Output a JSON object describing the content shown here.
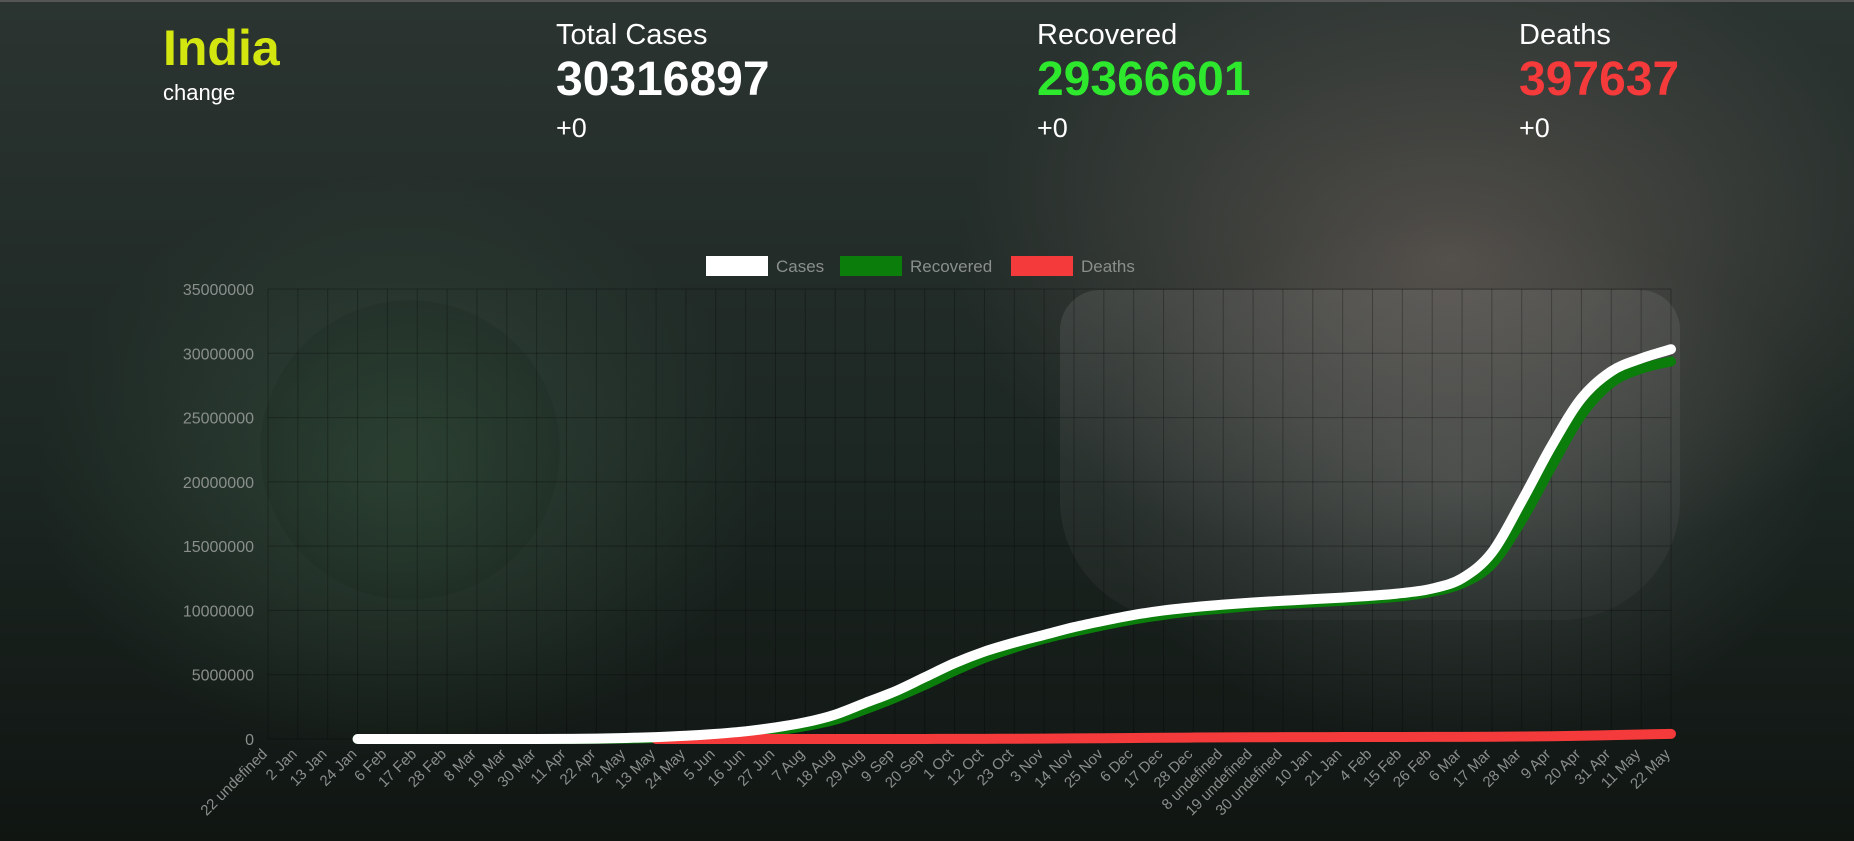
{
  "header": {
    "country": "India",
    "change_label": "change"
  },
  "stats": {
    "cases": {
      "label": "Total Cases",
      "value": "30316897",
      "delta": "+0",
      "color": "#ffffff"
    },
    "recovered": {
      "label": "Recovered",
      "value": "29366601",
      "delta": "+0",
      "color": "#2ee82e"
    },
    "deaths": {
      "label": "Deaths",
      "value": "397637",
      "delta": "+0",
      "color": "#f43a3a"
    }
  },
  "chart_data": {
    "type": "line",
    "grid": true,
    "legend_position": "top-center",
    "ylim": [
      0,
      35000000
    ],
    "yticks": [
      0,
      5000000,
      10000000,
      15000000,
      20000000,
      25000000,
      30000000,
      35000000
    ],
    "x": [
      "22 undefined",
      "2 Jan",
      "13 Jan",
      "24 Jan",
      "6 Feb",
      "17 Feb",
      "28 Feb",
      "8 Mar",
      "19 Mar",
      "30 Mar",
      "11 Apr",
      "22 Apr",
      "2 May",
      "13 May",
      "24 May",
      "5 Jun",
      "16 Jun",
      "27 Jun",
      "7 Aug",
      "18 Aug",
      "29 Aug",
      "9 Sep",
      "20 Sep",
      "1 Oct",
      "12 Oct",
      "23 Oct",
      "3 Nov",
      "14 Nov",
      "25 Nov",
      "6 Dec",
      "17 Dec",
      "28 Dec",
      "8 undefined",
      "19 undefined",
      "30 undefined",
      "10 Jan",
      "21 Jan",
      "4 Feb",
      "15 Feb",
      "26 Feb",
      "6 Mar",
      "17 Mar",
      "28 Mar",
      "9 Apr",
      "20 Apr",
      "31 Apr",
      "11 May",
      "22 May"
    ],
    "series": [
      {
        "name": "Cases",
        "color": "#ffffff",
        "values": [
          0,
          0,
          0,
          0,
          0,
          0,
          0,
          10000,
          30000,
          80000,
          150000,
          250000,
          400000,
          600000,
          900000,
          1300000,
          1900000,
          2800000,
          3700000,
          4800000,
          5900000,
          6800000,
          7500000,
          8100000,
          8700000,
          9200000,
          9650000,
          10000000,
          10250000,
          10450000,
          10620000,
          10750000,
          10880000,
          11000000,
          11150000,
          11350000,
          11700000,
          12500000,
          14500000,
          18500000,
          22800000,
          26500000,
          28600000,
          29600000,
          30316897
        ]
      },
      {
        "name": "Recovered",
        "color": "#0a7d0a",
        "values": [
          0,
          0,
          0,
          0,
          0,
          0,
          0,
          0,
          10000,
          30000,
          70000,
          150000,
          250000,
          400000,
          650000,
          1000000,
          1500000,
          2300000,
          3200000,
          4200000,
          5300000,
          6300000,
          7100000,
          7800000,
          8350000,
          8850000,
          9300000,
          9650000,
          9950000,
          10150000,
          10350000,
          10500000,
          10620000,
          10750000,
          10900000,
          11100000,
          11450000,
          12100000,
          13600000,
          17000000,
          21200000,
          25200000,
          27700000,
          28800000,
          29366601
        ]
      },
      {
        "name": "Deaths",
        "color": "#f43a3a",
        "values": [
          0,
          0,
          0,
          0,
          0,
          0,
          0,
          0,
          2000,
          4000,
          8000,
          14000,
          20000,
          30000,
          45000,
          62000,
          80000,
          98000,
          112000,
          125000,
          134000,
          142000,
          148000,
          152000,
          155000,
          158000,
          162000,
          168000,
          176000,
          190000,
          215000,
          250000,
          300000,
          350000,
          397637
        ]
      }
    ]
  }
}
